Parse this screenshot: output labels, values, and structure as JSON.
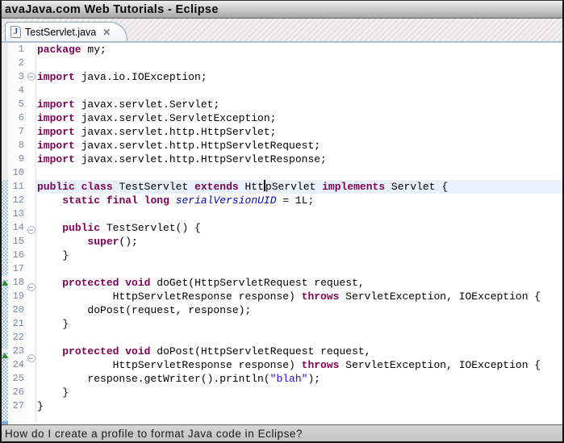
{
  "window": {
    "title": "avaJava.com Web Tutorials - Eclipse"
  },
  "tab": {
    "label": "TestServlet.java"
  },
  "icons": {
    "java_file": "J",
    "close": "✕",
    "fold_collapse": "−",
    "override": "▲"
  },
  "statusbar": {
    "text": "How do I create a profile to format Java code in Eclipse?"
  },
  "colors": {
    "keyword": "#7f0055",
    "string": "#2a00ff",
    "static_field": "#0000c0",
    "plain": "#000000",
    "current_line_bg": "#e9f2fc",
    "line_number": "#7b8aa0",
    "range_indicator": "#9cc2e5",
    "override_indicator": "#2f8f2f",
    "tab_border": "#8fa3b8",
    "tabstrip_divider": "#a9bfd4",
    "statusbar_bg": "#c9c9c9"
  },
  "editor": {
    "lines": [
      {
        "num": 1,
        "fold": false,
        "override": false,
        "range": false,
        "highlight": false,
        "tokens": [
          {
            "c": "k",
            "t": "package"
          },
          {
            "c": "p",
            "t": " my;"
          }
        ]
      },
      {
        "num": 2,
        "fold": false,
        "override": false,
        "range": false,
        "highlight": false,
        "tokens": []
      },
      {
        "num": 3,
        "fold": true,
        "override": false,
        "range": false,
        "highlight": false,
        "tokens": [
          {
            "c": "k",
            "t": "import"
          },
          {
            "c": "p",
            "t": " java.io.IOException;"
          }
        ]
      },
      {
        "num": 4,
        "fold": false,
        "override": false,
        "range": false,
        "highlight": false,
        "tokens": []
      },
      {
        "num": 5,
        "fold": false,
        "override": false,
        "range": false,
        "highlight": false,
        "tokens": [
          {
            "c": "k",
            "t": "import"
          },
          {
            "c": "p",
            "t": " javax.servlet.Servlet;"
          }
        ]
      },
      {
        "num": 6,
        "fold": false,
        "override": false,
        "range": false,
        "highlight": false,
        "tokens": [
          {
            "c": "k",
            "t": "import"
          },
          {
            "c": "p",
            "t": " javax.servlet.ServletException;"
          }
        ]
      },
      {
        "num": 7,
        "fold": false,
        "override": false,
        "range": false,
        "highlight": false,
        "tokens": [
          {
            "c": "k",
            "t": "import"
          },
          {
            "c": "p",
            "t": " javax.servlet.http.HttpServlet;"
          }
        ]
      },
      {
        "num": 8,
        "fold": false,
        "override": false,
        "range": false,
        "highlight": false,
        "tokens": [
          {
            "c": "k",
            "t": "import"
          },
          {
            "c": "p",
            "t": " javax.servlet.http.HttpServletRequest;"
          }
        ]
      },
      {
        "num": 9,
        "fold": false,
        "override": false,
        "range": false,
        "highlight": false,
        "tokens": [
          {
            "c": "k",
            "t": "import"
          },
          {
            "c": "p",
            "t": " javax.servlet.http.HttpServletResponse;"
          }
        ]
      },
      {
        "num": 10,
        "fold": false,
        "override": false,
        "range": false,
        "highlight": false,
        "tokens": []
      },
      {
        "num": 11,
        "fold": false,
        "override": false,
        "range": true,
        "highlight": true,
        "tokens": [
          {
            "c": "k",
            "t": "public"
          },
          {
            "c": "p",
            "t": " "
          },
          {
            "c": "k",
            "t": "class"
          },
          {
            "c": "p",
            "t": " TestServlet "
          },
          {
            "c": "k",
            "t": "extends"
          },
          {
            "c": "p",
            "t": " Htt"
          },
          {
            "c": "caret",
            "t": ""
          },
          {
            "c": "p",
            "t": "pServlet "
          },
          {
            "c": "k",
            "t": "implements"
          },
          {
            "c": "p",
            "t": " Servlet {"
          }
        ]
      },
      {
        "num": 12,
        "fold": false,
        "override": false,
        "range": true,
        "highlight": false,
        "tokens": [
          {
            "c": "p",
            "t": "    "
          },
          {
            "c": "k",
            "t": "static"
          },
          {
            "c": "p",
            "t": " "
          },
          {
            "c": "k",
            "t": "final"
          },
          {
            "c": "p",
            "t": " "
          },
          {
            "c": "k",
            "t": "long"
          },
          {
            "c": "p",
            "t": " "
          },
          {
            "c": "f",
            "t": "serialVersionUID"
          },
          {
            "c": "p",
            "t": " = 1L;"
          }
        ]
      },
      {
        "num": 13,
        "fold": false,
        "override": false,
        "range": true,
        "highlight": false,
        "tokens": []
      },
      {
        "num": 14,
        "fold": true,
        "override": false,
        "range": true,
        "highlight": false,
        "tokens": [
          {
            "c": "p",
            "t": "    "
          },
          {
            "c": "k",
            "t": "public"
          },
          {
            "c": "p",
            "t": " TestServlet() {"
          }
        ]
      },
      {
        "num": 15,
        "fold": false,
        "override": false,
        "range": true,
        "highlight": false,
        "tokens": [
          {
            "c": "p",
            "t": "        "
          },
          {
            "c": "k",
            "t": "super"
          },
          {
            "c": "p",
            "t": "();"
          }
        ]
      },
      {
        "num": 16,
        "fold": false,
        "override": false,
        "range": true,
        "highlight": false,
        "tokens": [
          {
            "c": "p",
            "t": "    }"
          }
        ]
      },
      {
        "num": 17,
        "fold": false,
        "override": false,
        "range": true,
        "highlight": false,
        "tokens": []
      },
      {
        "num": 18,
        "fold": true,
        "override": true,
        "range": true,
        "highlight": false,
        "tokens": [
          {
            "c": "p",
            "t": "    "
          },
          {
            "c": "k",
            "t": "protected"
          },
          {
            "c": "p",
            "t": " "
          },
          {
            "c": "k",
            "t": "void"
          },
          {
            "c": "p",
            "t": " doGet(HttpServletRequest request,"
          }
        ]
      },
      {
        "num": 19,
        "fold": false,
        "override": false,
        "range": true,
        "highlight": false,
        "tokens": [
          {
            "c": "p",
            "t": "            HttpServletResponse response) "
          },
          {
            "c": "k",
            "t": "throws"
          },
          {
            "c": "p",
            "t": " ServletException, IOException {"
          }
        ]
      },
      {
        "num": 20,
        "fold": false,
        "override": false,
        "range": true,
        "highlight": false,
        "tokens": [
          {
            "c": "p",
            "t": "        doPost(request, response);"
          }
        ]
      },
      {
        "num": 21,
        "fold": false,
        "override": false,
        "range": true,
        "highlight": false,
        "tokens": [
          {
            "c": "p",
            "t": "    }"
          }
        ]
      },
      {
        "num": 22,
        "fold": false,
        "override": false,
        "range": true,
        "highlight": false,
        "tokens": []
      },
      {
        "num": 23,
        "fold": true,
        "override": true,
        "range": true,
        "highlight": false,
        "tokens": [
          {
            "c": "p",
            "t": "    "
          },
          {
            "c": "k",
            "t": "protected"
          },
          {
            "c": "p",
            "t": " "
          },
          {
            "c": "k",
            "t": "void"
          },
          {
            "c": "p",
            "t": " doPost(HttpServletRequest request,"
          }
        ]
      },
      {
        "num": 24,
        "fold": false,
        "override": false,
        "range": true,
        "highlight": false,
        "tokens": [
          {
            "c": "p",
            "t": "            HttpServletResponse response) "
          },
          {
            "c": "k",
            "t": "throws"
          },
          {
            "c": "p",
            "t": " ServletException, IOException {"
          }
        ]
      },
      {
        "num": 25,
        "fold": false,
        "override": false,
        "range": true,
        "highlight": false,
        "tokens": [
          {
            "c": "p",
            "t": "        response.getWriter().println("
          },
          {
            "c": "s",
            "t": "\"blah\""
          },
          {
            "c": "p",
            "t": ");"
          }
        ]
      },
      {
        "num": 26,
        "fold": false,
        "override": false,
        "range": true,
        "highlight": false,
        "tokens": [
          {
            "c": "p",
            "t": "    }"
          }
        ]
      },
      {
        "num": 27,
        "fold": false,
        "override": false,
        "range": true,
        "highlight": false,
        "tokens": [
          {
            "c": "p",
            "t": "}"
          }
        ]
      }
    ]
  }
}
